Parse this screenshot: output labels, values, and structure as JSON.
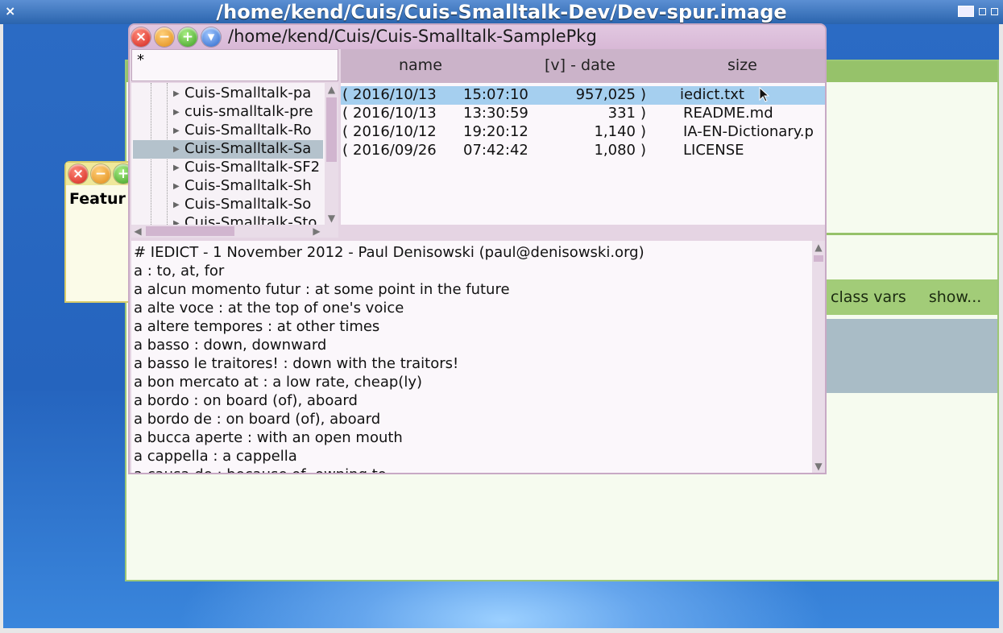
{
  "desktop": {
    "window_title": "/home/kend/Cuis/Cuis-Smalltalk-Dev/Dev-spur.image",
    "close_glyph": "×"
  },
  "background_window": {
    "tabs": [
      "class vars",
      "show..."
    ]
  },
  "feature_window": {
    "label": "Featur"
  },
  "file_browser": {
    "title": "/home/kend/Cuis/Cuis-Smalltalk-SamplePkg",
    "filter_text": "*",
    "columns": {
      "name": "name",
      "date": "[v] - date",
      "size": "size"
    },
    "tree_items": [
      {
        "label": "Cuis-Smalltalk-pa",
        "selected": false
      },
      {
        "label": "cuis-smalltalk-pre",
        "selected": false
      },
      {
        "label": "Cuis-Smalltalk-Ro",
        "selected": false
      },
      {
        "label": "Cuis-Smalltalk-Sa",
        "selected": true
      },
      {
        "label": "Cuis-Smalltalk-SF2",
        "selected": false
      },
      {
        "label": "Cuis-Smalltalk-Sh",
        "selected": false
      },
      {
        "label": "Cuis-Smalltalk-So",
        "selected": false
      },
      {
        "label": "Cuis-Smalltalk-Sto",
        "selected": false
      }
    ],
    "files": [
      {
        "open": "(",
        "date": "2016/10/13",
        "time": "15:07:10",
        "size": "957,025",
        "close": ")",
        "name": "iedict.txt",
        "selected": true
      },
      {
        "open": "(",
        "date": "2016/10/13",
        "time": "13:30:59",
        "size": "331",
        "close": ")",
        "name": "README.md",
        "selected": false
      },
      {
        "open": "(",
        "date": "2016/10/12",
        "time": "19:20:12",
        "size": "1,140",
        "close": ")",
        "name": "IA-EN-Dictionary.p",
        "selected": false
      },
      {
        "open": "(",
        "date": "2016/09/26",
        "time": "07:42:42",
        "size": "1,080",
        "close": ")",
        "name": "LICENSE",
        "selected": false
      }
    ],
    "content_lines": [
      "# IEDICT - 1 November 2012 - Paul Denisowski (paul@denisowski.org)",
      "a : to, at, for",
      "a alcun momento futur : at some point in the future",
      "a alte voce : at the top of one's voice",
      "a altere tempores : at other times",
      "a basso : down, downward",
      "a basso le traitores! : down with the traitors!",
      "a bon mercato at : a low rate, cheap(ly)",
      "a bordo : on board (of), aboard",
      "a bordo de : on board (of), aboard",
      "a bucca aperte : with an open mouth",
      "a cappella : a cappella",
      "a causa de : because of, owning to"
    ]
  }
}
